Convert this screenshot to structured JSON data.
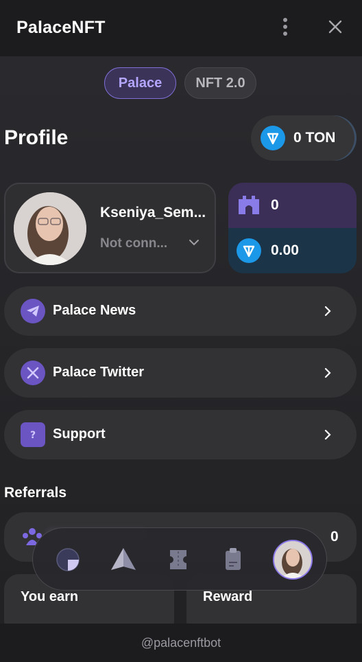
{
  "header": {
    "title": "PalaceNFT"
  },
  "segments": [
    {
      "label": "Palace",
      "active": true
    },
    {
      "label": "NFT 2.0",
      "active": false
    }
  ],
  "profile": {
    "title": "Profile",
    "ton_balance_label": "0 TON",
    "username": "Kseniya_Sem...",
    "wallet_status": "Not conn..."
  },
  "balances": {
    "palace_tokens": "0",
    "ton": "0.00"
  },
  "menu": [
    {
      "label": "Palace News",
      "icon": "telegram-icon"
    },
    {
      "label": "Palace Twitter",
      "icon": "x-logo-icon"
    },
    {
      "label": "Support",
      "icon": "question-chat-icon"
    }
  ],
  "referrals": {
    "title": "Referrals",
    "count": "0",
    "you_earn_label": "You earn",
    "reward_label": "Reward"
  },
  "tabs": [
    {
      "name": "dashboard",
      "icon": "pie-icon"
    },
    {
      "name": "explore",
      "icon": "pyramid-icon"
    },
    {
      "name": "tasks",
      "icon": "ticket-icon"
    },
    {
      "name": "clipboard",
      "icon": "clipboard-icon"
    },
    {
      "name": "profile",
      "icon": "avatar"
    }
  ],
  "footer": {
    "bot_handle": "@palacenftbot"
  },
  "colors": {
    "accent": "#7f6fd6",
    "ton_blue": "#1c98e8",
    "background": "#1c1c1e",
    "card": "#323235"
  }
}
